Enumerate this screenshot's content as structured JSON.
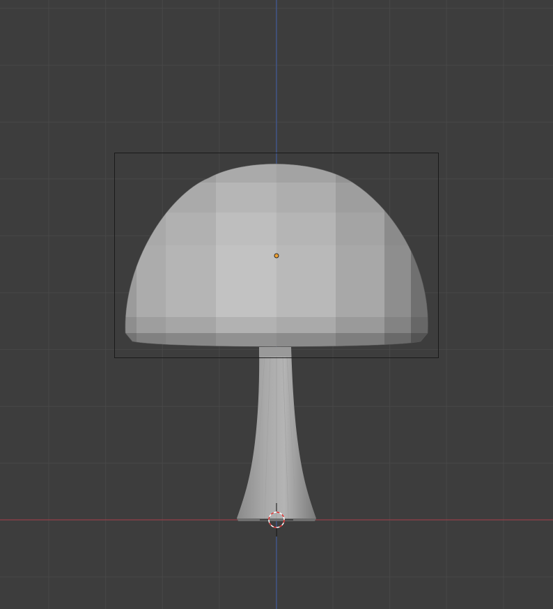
{
  "viewport": {
    "view": "front-orthographic",
    "background_color": "#3d3d3d",
    "grid_color": "#484848",
    "axis_colors": {
      "x_axis": "#a83c46",
      "z_axis": "#3d5ca8"
    },
    "selection_outline_color": "#1a1a1a",
    "origin_color": "#f0a030",
    "cursor_colors": [
      "#e03030",
      "#ffffff"
    ]
  },
  "scene": {
    "object": {
      "kind": "mushroom-mesh",
      "shading": "solid",
      "parts": [
        "cap",
        "stem"
      ]
    }
  }
}
